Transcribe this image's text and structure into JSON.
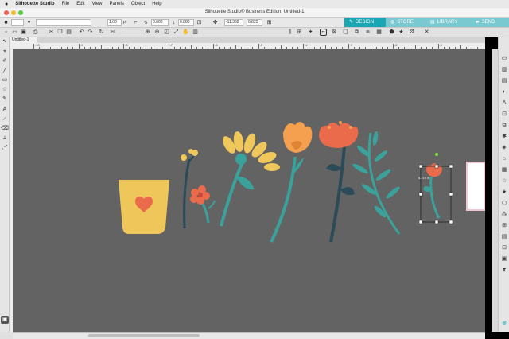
{
  "menubar": {
    "apple": "",
    "app_name": "Silhouette Studio",
    "items": [
      "File",
      "Edit",
      "View",
      "Panels",
      "Object",
      "Help"
    ]
  },
  "window": {
    "title": "Silhouette Studio® Business Edition: Untitled-1"
  },
  "nav_tabs": [
    {
      "label": "DESIGN",
      "icon": "design-icon"
    },
    {
      "label": "STORE",
      "icon": "store-icon"
    },
    {
      "label": "LIBRARY",
      "icon": "library-icon"
    },
    {
      "label": "SEND",
      "icon": "send-icon"
    }
  ],
  "toolbar": {
    "line_width": "1.00",
    "line_unit": "pt",
    "pos_x": "8.000",
    "pos_y": "0.880",
    "width": "-11.352",
    "height": "6.823"
  },
  "document": {
    "tab_label": "Untitled-1",
    "ruler_labels": [
      "-10",
      "-9",
      "-8",
      "-7",
      "-6",
      "-5",
      "-4",
      "-3",
      "-2",
      "-1"
    ]
  },
  "selection": {
    "width_label": "6.219 in"
  },
  "colors": {
    "canvas": "#636363",
    "accent_tab": "#1aa6b3",
    "pot": "#eec65a",
    "heart": "#ea6a4c",
    "stem_teal": "#3aa29a",
    "stem_dark": "#2a4b57",
    "petal_yellow": "#f0c75a",
    "petal_orange": "#f4a04f",
    "petal_red": "#ea6a4c"
  }
}
